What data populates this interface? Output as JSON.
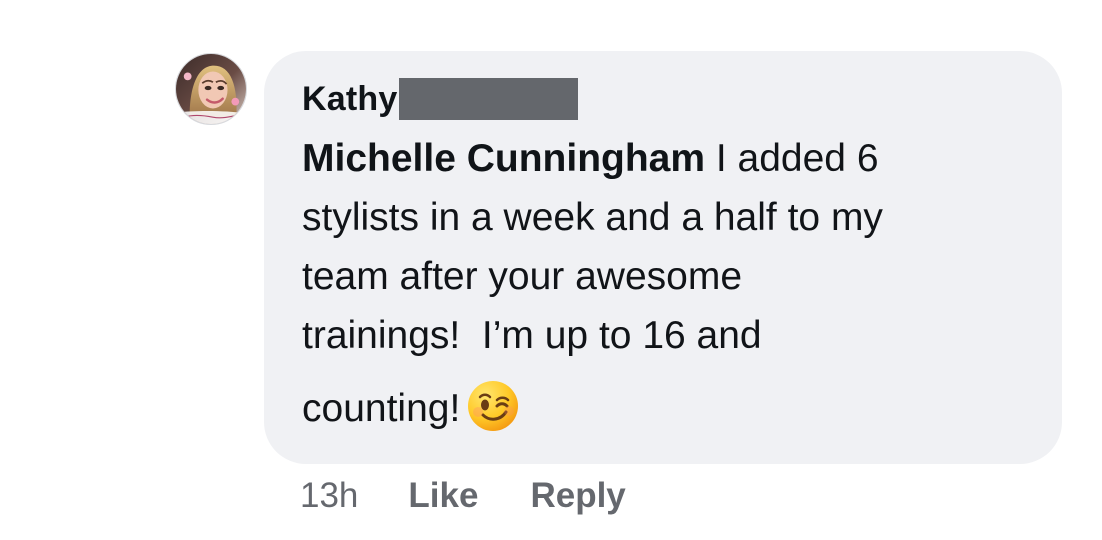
{
  "comment": {
    "author_first_name": "Kathy",
    "author_last_name_redacted": true,
    "mention": "Michelle Cunningham",
    "text_line_1": " I added 6",
    "text_line_2": "stylists in a week and a half to my",
    "text_line_3": "team after your awesome",
    "text_line_4": "trainings!  I’m up to 16 and",
    "text_line_5": "counting!",
    "emoji_icon": "winking-face-emoji",
    "avatar_icon": "profile-photo"
  },
  "actions": {
    "timestamp": "13h",
    "like_label": "Like",
    "reply_label": "Reply"
  },
  "colors": {
    "bubble_background": "#f0f1f4",
    "secondary_text": "#65686e",
    "redaction_block": "#64676c"
  }
}
